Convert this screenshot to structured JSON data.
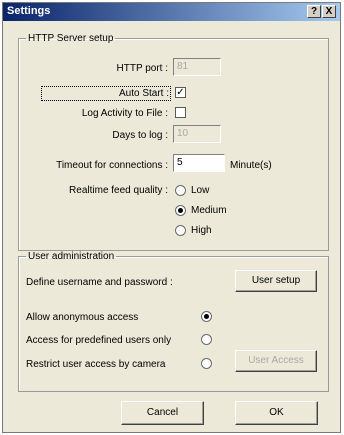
{
  "window": {
    "title": "Settings",
    "help_label": "?",
    "close_label": "X"
  },
  "http_server": {
    "legend": "HTTP Server setup",
    "port_label": "HTTP port :",
    "port_value": "81",
    "autostart_label": "Auto Start :",
    "autostart_checked": true,
    "log_label": "Log Activity to File :",
    "log_checked": false,
    "days_label": "Days to log :",
    "days_value": "10",
    "timeout_label": "Timeout for connections :",
    "timeout_value": "5",
    "timeout_unit": "Minute(s)",
    "quality_label": "Realtime feed quality :",
    "quality_options": [
      "Low",
      "Medium",
      "High"
    ],
    "quality_selected": "Medium"
  },
  "user_admin": {
    "legend": "User administration",
    "define_label": "Define username and password :",
    "user_setup_label": "User setup",
    "access_options": [
      {
        "label": "Allow anonymous access",
        "selected": true
      },
      {
        "label": "Access for predefined users only",
        "selected": false
      },
      {
        "label": "Restrict user access by camera",
        "selected": false
      }
    ],
    "user_access_label": "User Access"
  },
  "buttons": {
    "cancel": "Cancel",
    "ok": "OK"
  }
}
